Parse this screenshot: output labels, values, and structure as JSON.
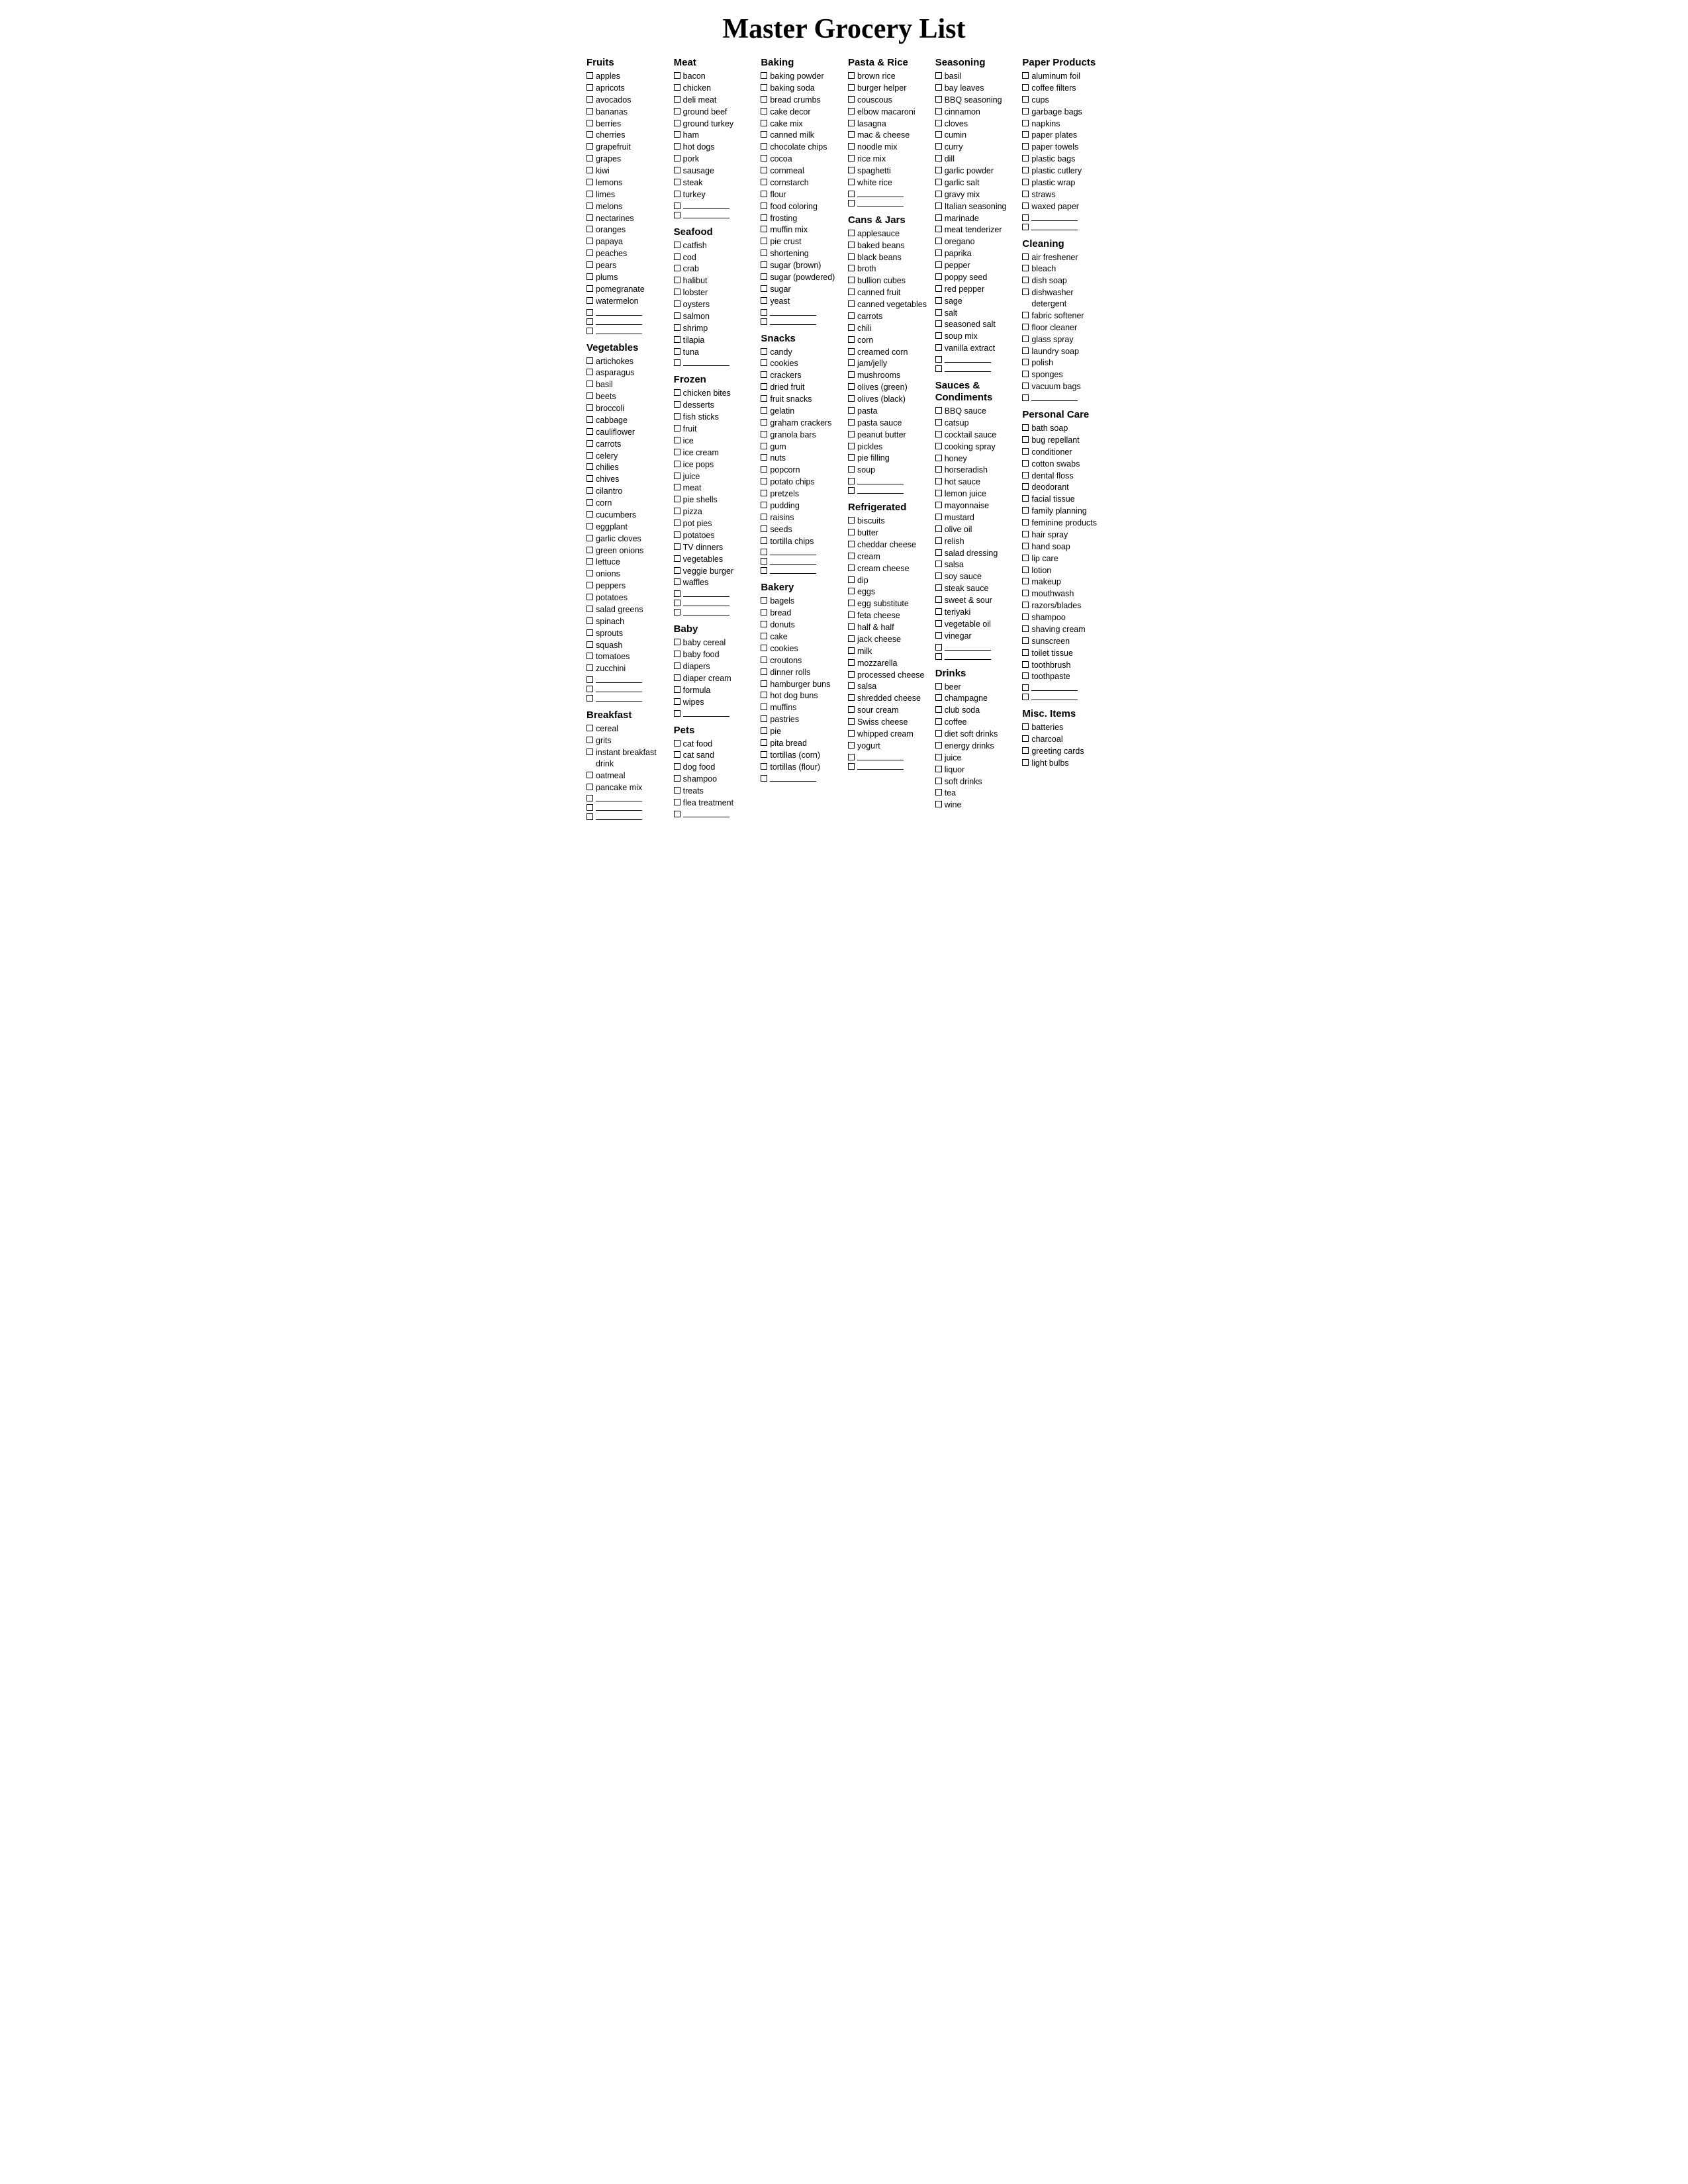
{
  "title": "Master Grocery List",
  "columns": [
    {
      "sections": [
        {
          "title": "Fruits",
          "items": [
            "apples",
            "apricots",
            "avocados",
            "bananas",
            "berries",
            "cherries",
            "grapefruit",
            "grapes",
            "kiwi",
            "lemons",
            "limes",
            "melons",
            "nectarines",
            "oranges",
            "papaya",
            "peaches",
            "pears",
            "plums",
            "pomegranate",
            "watermelon"
          ],
          "blanks": 3
        },
        {
          "title": "Vegetables",
          "items": [
            "artichokes",
            "asparagus",
            "basil",
            "beets",
            "broccoli",
            "cabbage",
            "cauliflower",
            "carrots",
            "celery",
            "chilies",
            "chives",
            "cilantro",
            "corn",
            "cucumbers",
            "eggplant",
            "garlic cloves",
            "green onions",
            "lettuce",
            "onions",
            "peppers",
            "potatoes",
            "salad greens",
            "spinach",
            "sprouts",
            "squash",
            "tomatoes",
            "zucchini"
          ],
          "blanks": 3
        },
        {
          "title": "Breakfast",
          "items": [
            "cereal",
            "grits",
            "instant breakfast drink",
            "oatmeal",
            "pancake mix"
          ],
          "blanks": 3
        }
      ]
    },
    {
      "sections": [
        {
          "title": "Meat",
          "items": [
            "bacon",
            "chicken",
            "deli meat",
            "ground beef",
            "ground turkey",
            "ham",
            "hot dogs",
            "pork",
            "sausage",
            "steak",
            "turkey"
          ],
          "blanks": 2
        },
        {
          "title": "Seafood",
          "items": [
            "catfish",
            "cod",
            "crab",
            "halibut",
            "lobster",
            "oysters",
            "salmon",
            "shrimp",
            "tilapia",
            "tuna"
          ],
          "blanks": 1
        },
        {
          "title": "Frozen",
          "items": [
            "chicken bites",
            "desserts",
            "fish sticks",
            "fruit",
            "ice",
            "ice cream",
            "ice pops",
            "juice",
            "meat",
            "pie shells",
            "pizza",
            "pot pies",
            "potatoes",
            "TV dinners",
            "vegetables",
            "veggie burger",
            "waffles"
          ],
          "blanks": 3
        },
        {
          "title": "Baby",
          "items": [
            "baby cereal",
            "baby food",
            "diapers",
            "diaper cream",
            "formula",
            "wipes"
          ],
          "blanks": 1
        },
        {
          "title": "Pets",
          "items": [
            "cat food",
            "cat sand",
            "dog food",
            "shampoo",
            "treats",
            "flea treatment"
          ],
          "blanks": 1
        }
      ]
    },
    {
      "sections": [
        {
          "title": "Baking",
          "items": [
            "baking powder",
            "baking soda",
            "bread crumbs",
            "cake decor",
            "cake mix",
            "canned milk",
            "chocolate chips",
            "cocoa",
            "cornmeal",
            "cornstarch",
            "flour",
            "food coloring",
            "frosting",
            "muffin mix",
            "pie crust",
            "shortening",
            "sugar (brown)",
            "sugar (powdered)",
            "sugar",
            "yeast"
          ],
          "blanks": 2
        },
        {
          "title": "Snacks",
          "items": [
            "candy",
            "cookies",
            "crackers",
            "dried fruit",
            "fruit snacks",
            "gelatin",
            "graham crackers",
            "granola bars",
            "gum",
            "nuts",
            "popcorn",
            "potato chips",
            "pretzels",
            "pudding",
            "raisins",
            "seeds",
            "tortilla chips"
          ],
          "blanks": 3
        },
        {
          "title": "Bakery",
          "items": [
            "bagels",
            "bread",
            "donuts",
            "cake",
            "cookies",
            "croutons",
            "dinner rolls",
            "hamburger buns",
            "hot dog buns",
            "muffins",
            "pastries",
            "pie",
            "pita bread",
            "tortillas (corn)",
            "tortillas (flour)"
          ],
          "blanks": 1
        }
      ]
    },
    {
      "sections": [
        {
          "title": "Pasta & Rice",
          "items": [
            "brown rice",
            "burger helper",
            "couscous",
            "elbow macaroni",
            "lasagna",
            "mac & cheese",
            "noodle mix",
            "rice mix",
            "spaghetti",
            "white rice"
          ],
          "blanks": 2
        },
        {
          "title": "Cans & Jars",
          "items": [
            "applesauce",
            "baked beans",
            "black beans",
            "broth",
            "bullion cubes",
            "canned fruit",
            "canned vegetables",
            "carrots",
            "chili",
            "corn",
            "creamed corn",
            "jam/jelly",
            "mushrooms",
            "olives (green)",
            "olives (black)",
            "pasta",
            "pasta sauce",
            "peanut butter",
            "pickles",
            "pie filling",
            "soup"
          ],
          "blanks": 2
        },
        {
          "title": "Refrigerated",
          "items": [
            "biscuits",
            "butter",
            "cheddar cheese",
            "cream",
            "cream cheese",
            "dip",
            "eggs",
            "egg substitute",
            "feta cheese",
            "half & half",
            "jack cheese",
            "milk",
            "mozzarella",
            "processed cheese",
            "salsa",
            "shredded cheese",
            "sour cream",
            "Swiss cheese",
            "whipped cream",
            "yogurt"
          ],
          "blanks": 2
        }
      ]
    },
    {
      "sections": [
        {
          "title": "Seasoning",
          "items": [
            "basil",
            "bay leaves",
            "BBQ seasoning",
            "cinnamon",
            "cloves",
            "cumin",
            "curry",
            "dill",
            "garlic powder",
            "garlic salt",
            "gravy mix",
            "Italian seasoning",
            "marinade",
            "meat tenderizer",
            "oregano",
            "paprika",
            "pepper",
            "poppy seed",
            "red pepper",
            "sage",
            "salt",
            "seasoned salt",
            "soup mix",
            "vanilla extract"
          ],
          "blanks": 2
        },
        {
          "title": "Sauces & Condiments",
          "items": [
            "BBQ sauce",
            "catsup",
            "cocktail sauce",
            "cooking spray",
            "honey",
            "horseradish",
            "hot sauce",
            "lemon juice",
            "mayonnaise",
            "mustard",
            "olive oil",
            "relish",
            "salad dressing",
            "salsa",
            "soy sauce",
            "steak sauce",
            "sweet & sour",
            "teriyaki",
            "vegetable oil",
            "vinegar"
          ],
          "blanks": 2
        },
        {
          "title": "Drinks",
          "items": [
            "beer",
            "champagne",
            "club soda",
            "coffee",
            "diet soft drinks",
            "energy drinks",
            "juice",
            "liquor",
            "soft drinks",
            "tea",
            "wine"
          ],
          "blanks": 0
        }
      ]
    },
    {
      "sections": [
        {
          "title": "Paper Products",
          "items": [
            "aluminum foil",
            "coffee filters",
            "cups",
            "garbage bags",
            "napkins",
            "paper plates",
            "paper towels",
            "plastic bags",
            "plastic cutlery",
            "plastic wrap",
            "straws",
            "waxed paper"
          ],
          "blanks": 2
        },
        {
          "title": "Cleaning",
          "items": [
            "air freshener",
            "bleach",
            "dish soap",
            "dishwasher detergent",
            "fabric softener",
            "floor cleaner",
            "glass spray",
            "laundry soap",
            "polish",
            "sponges",
            "vacuum bags"
          ],
          "blanks": 1
        },
        {
          "title": "Personal Care",
          "items": [
            "bath soap",
            "bug repellant",
            "conditioner",
            "cotton swabs",
            "dental floss",
            "deodorant",
            "facial tissue",
            "family planning",
            "feminine products",
            "hair spray",
            "hand soap",
            "lip care",
            "lotion",
            "makeup",
            "mouthwash",
            "razors/blades",
            "shampoo",
            "shaving cream",
            "sunscreen",
            "toilet tissue",
            "toothbrush",
            "toothpaste"
          ],
          "blanks": 2
        },
        {
          "title": "Misc. Items",
          "items": [
            "batteries",
            "charcoal",
            "greeting cards",
            "light bulbs"
          ],
          "blanks": 0
        }
      ]
    }
  ]
}
